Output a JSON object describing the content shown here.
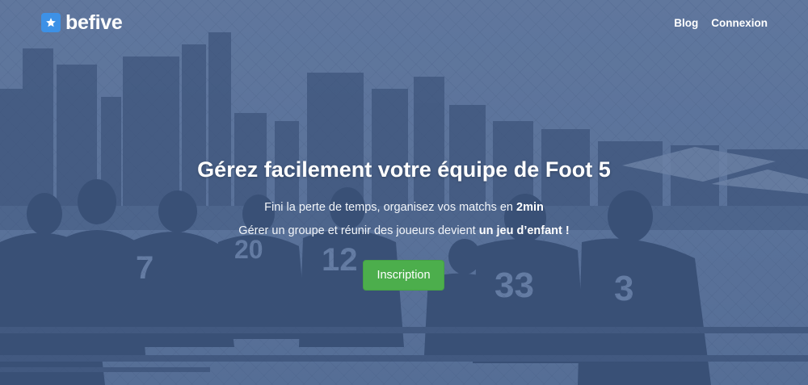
{
  "brand": {
    "logo_icon": "star-icon",
    "name": "befive",
    "accent_color": "#3d91e6"
  },
  "nav": {
    "items": [
      {
        "label": "Blog"
      },
      {
        "label": "Connexion"
      }
    ]
  },
  "hero": {
    "headline": "Gérez facilement votre équipe de Foot 5",
    "line1_text": "Fini la perte de temps, organisez vos matchs en ",
    "line1_strong": "2min",
    "line2_text": "Gérer un groupe et réunir des joueurs devient ",
    "line2_strong": "un jeu d’enfant !",
    "cta_label": "Inscription",
    "cta_color": "#4cae4c",
    "overlay_color": "#4e6891",
    "jersey_numbers": [
      "7",
      "20",
      "12",
      "33",
      "3"
    ]
  }
}
